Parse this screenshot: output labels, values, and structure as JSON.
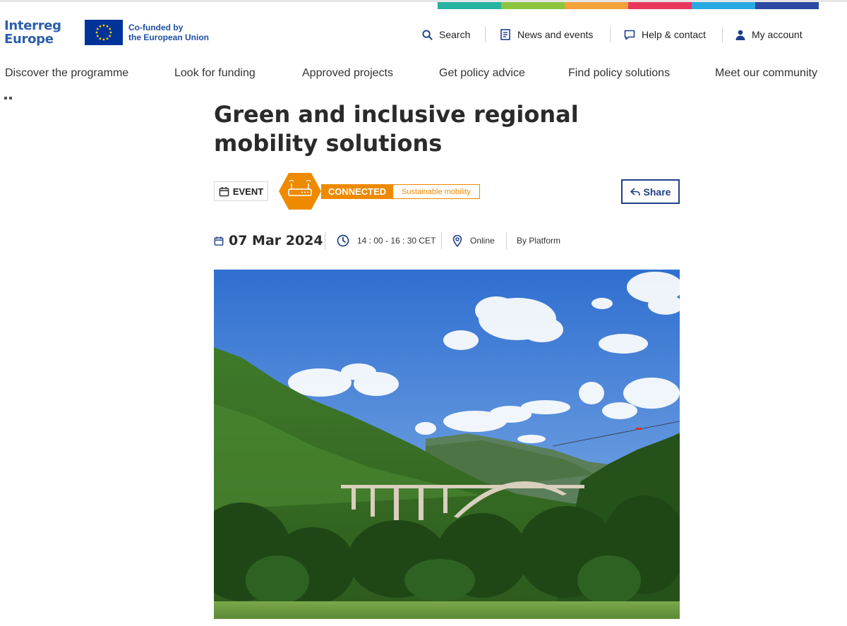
{
  "colors": {
    "brand_blue": "#2b5eab",
    "eu_blue": "#003399",
    "accent_orange": "#ee8a00",
    "share_blue": "#1e3f8a",
    "colorbar": [
      "#26b3a0",
      "#8cc63f",
      "#f4a23b",
      "#e8365d",
      "#29a9e1",
      "#2c4aa0"
    ]
  },
  "header": {
    "logo": {
      "line1": "Interreg",
      "line2": "Europe"
    },
    "eu_label": {
      "line1": "Co-funded by",
      "line2": "the European Union"
    },
    "utility_nav": [
      {
        "label": "Search",
        "icon": "search-icon"
      },
      {
        "label": "News and events",
        "icon": "newspaper-icon"
      },
      {
        "label": "Help & contact",
        "icon": "chat-bubble-icon"
      },
      {
        "label": "My account",
        "icon": "user-icon"
      }
    ],
    "main_nav": [
      "Discover the programme",
      "Look for funding",
      "Approved projects",
      "Get policy advice",
      "Find policy solutions",
      "Meet our community"
    ]
  },
  "event": {
    "title": "Green and inclusive regional mobility solutions",
    "type_badge": "EVENT",
    "badge_icon": "router-icon",
    "status_label": "CONNECTED",
    "topic": "Sustainable mobility",
    "share_label": "Share",
    "date": "07 Mar 2024",
    "time": "14 : 00 - 16 : 30 CET",
    "location": "Online",
    "organiser": "By Platform"
  },
  "image": {
    "description": "Mountain valley with a concrete arch bridge under a blue sky with clouds"
  }
}
